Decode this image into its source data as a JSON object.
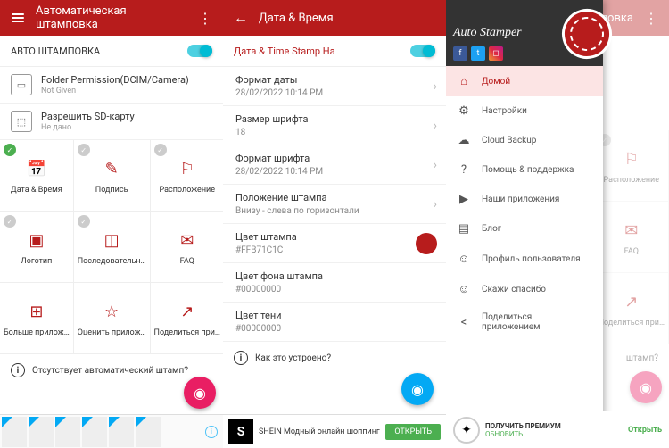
{
  "p1": {
    "title": "Автоматическая штамповка",
    "auto_stamp": "АВТО ШТАМПОВКА",
    "folder": {
      "t1": "Folder Permission(DCIM/Camera)",
      "t2": "Not Given"
    },
    "sd": {
      "t1": "Разрешить SD-карту",
      "t2": "Не дано"
    },
    "cells": [
      {
        "label": "Дата & Время",
        "check": "on"
      },
      {
        "label": "Подпись",
        "check": "off"
      },
      {
        "label": "Расположение",
        "check": "off"
      },
      {
        "label": "Логотип",
        "check": "off"
      },
      {
        "label": "Последовательн…",
        "check": "off"
      },
      {
        "label": "FAQ"
      },
      {
        "label": "Больше прилож…"
      },
      {
        "label": "Оценить прилож…"
      },
      {
        "label": "Поделиться при…"
      }
    ],
    "info": "Отсутствует автоматический штамп?"
  },
  "p2": {
    "title": "Дата & Время",
    "sub": "Дата & Time Stamp На",
    "rows": [
      {
        "s1": "Формат даты",
        "s2": "28/02/2022 10:14 PM",
        "chev": true
      },
      {
        "s1": "Размер шрифта",
        "s2": "18",
        "chev": true
      },
      {
        "s1": "Формат шрифта",
        "s2": "28/02/2022 10:14 PM",
        "chev": true
      },
      {
        "s1": "Положение штампа",
        "s2": "Внизу - слева по горизонтали",
        "chev": true
      },
      {
        "s1": "Цвет штампа",
        "s2": "#FFB71C1C",
        "dot": true
      },
      {
        "s1": "Цвет фона штампа",
        "s2": "#00000000"
      },
      {
        "s1": "Цвет тени",
        "s2": "#00000000"
      }
    ],
    "how": "Как это устроено?",
    "ad": {
      "brand": "S",
      "text": "SHEIN Модный онлайн шоппинг",
      "btn": "ОТКРЫТЬ"
    }
  },
  "p3": {
    "apptitle": "Auto Stamper",
    "bar_tail": "мповка",
    "items": [
      {
        "icon": "⌂",
        "label": "Домой",
        "active": true
      },
      {
        "icon": "⚙",
        "label": "Настройки"
      },
      {
        "icon": "☁",
        "label": "Cloud Backup"
      },
      {
        "icon": "?",
        "label": "Помощь & поддержка"
      },
      {
        "icon": "▶",
        "label": "Наши приложения"
      },
      {
        "icon": "▤",
        "label": "Блог"
      },
      {
        "icon": "☺",
        "label": "Профиль пользователя"
      },
      {
        "icon": "☺",
        "label": "Скажи спасибо"
      },
      {
        "icon": "<",
        "label": "Поделиться приложением"
      }
    ],
    "behind_cells": [
      "Расположение",
      "FAQ",
      "Поделиться при…"
    ],
    "behind_info": "штамп?",
    "premium": {
      "t1": "ПОЛУЧИТЬ ПРЕМИУМ",
      "t2": "ОБНОВИТЬ",
      "btn": "Открыть"
    }
  }
}
